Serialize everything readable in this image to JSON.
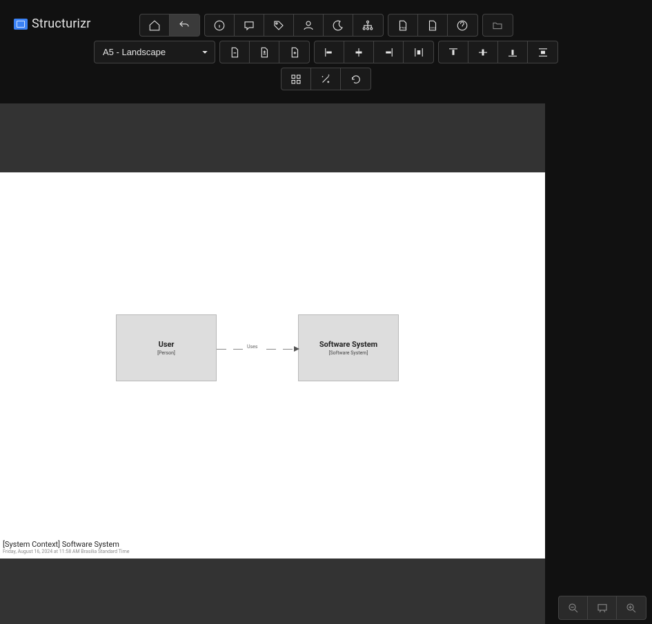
{
  "app": {
    "name": "Structurizr"
  },
  "toolbar": {
    "page_size_selected": "A5 - Landscape"
  },
  "canvas": {
    "caption_title": "[System Context] Software System",
    "caption_time": "Friday, August 16, 2024 at 11:58 AM Brasilia Standard Time",
    "nodes": {
      "user": {
        "title": "User",
        "subtitle": "[Person]"
      },
      "system": {
        "title": "Software System",
        "subtitle": "[Software System]"
      }
    },
    "relation": {
      "label": "Uses"
    }
  }
}
